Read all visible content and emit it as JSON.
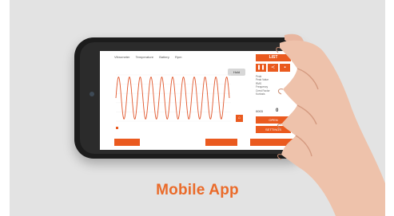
{
  "page": {
    "title": "Mobile App"
  },
  "colors": {
    "accent": "#ea6b2a",
    "wave": "#e1552a",
    "background": "#e3e3e3"
  },
  "app_header": [
    "Vibrometer",
    "Temperature",
    "Battery",
    "Rpm"
  ],
  "buttons": {
    "list": "LIST",
    "hold": "Hold",
    "open": "OPEN",
    "settings": "SETTINGS",
    "bottom_left": "",
    "bottom_mid": "",
    "bottom_right": ""
  },
  "stats": [
    "Peak",
    "Peak Value",
    "RMS",
    "Frequency",
    "Crest Factor",
    "Kurtosis"
  ],
  "sensor": {
    "label": "0003",
    "value": "0"
  },
  "icons": {
    "pause": "pause-icon",
    "share": "share-icon",
    "save": "save-icon",
    "home": "home-icon",
    "chart": "chart-icon"
  },
  "chart_data": {
    "type": "line",
    "title": "",
    "xlabel": "",
    "ylabel": "",
    "grid": true,
    "legend": "bottom-left",
    "series": [
      {
        "name": "",
        "cycles": 10.5,
        "amplitude": 1.0
      }
    ],
    "ylim": [
      -1.1,
      1.1
    ]
  }
}
